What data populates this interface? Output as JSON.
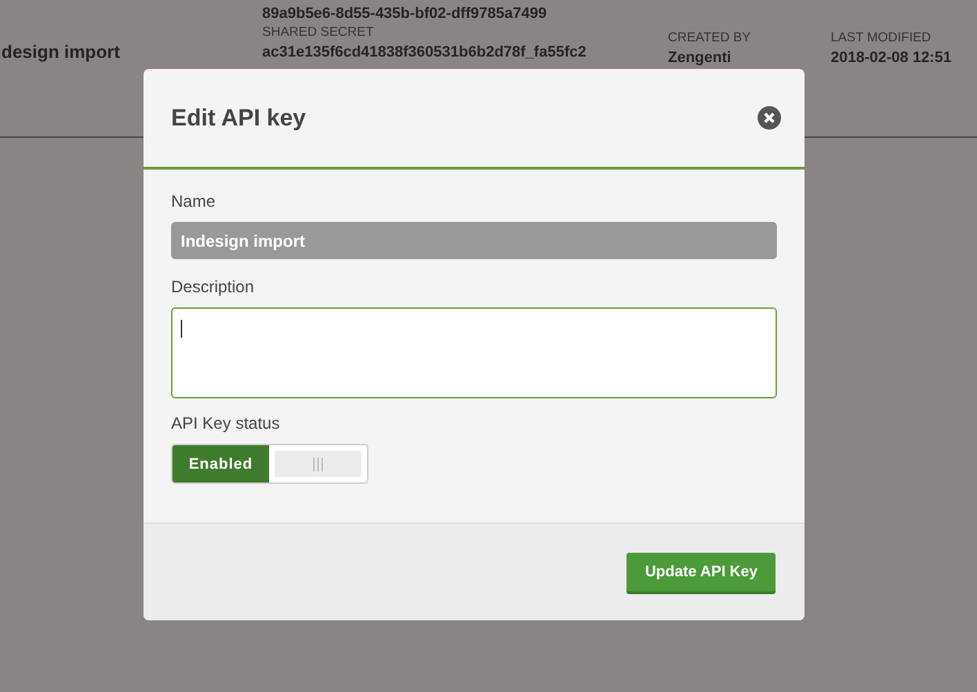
{
  "background_row": {
    "name": "design import",
    "key": "89a9b5e6-8d55-435b-bf02-dff9785a7499",
    "shared_secret_label": "SHARED SECRET",
    "shared_secret": "ac31e135f6cd41838f360531b6b2d78f_fa55fc2",
    "created_by_label": "CREATED BY",
    "created_by": "Zengenti",
    "last_modified_label": "LAST MODIFIED",
    "last_modified": "2018-02-08 12:51"
  },
  "dialog": {
    "title": "Edit API key",
    "name_label": "Name",
    "name_value": "Indesign import",
    "description_label": "Description",
    "description_focused": true,
    "status_label": "API Key status",
    "status": {
      "on": true,
      "label": "Enabled"
    },
    "button": "Update API Key"
  }
}
